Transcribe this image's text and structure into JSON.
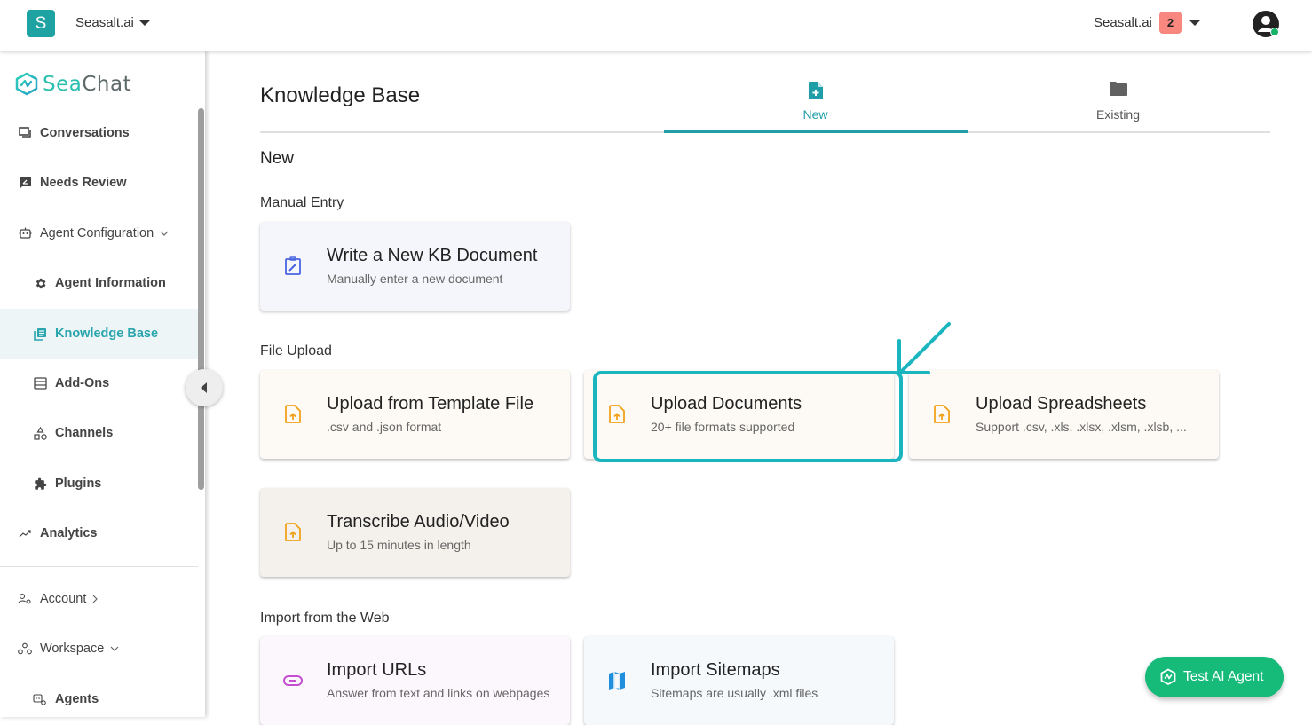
{
  "topbar": {
    "workspace_initial": "S",
    "workspace_name": "Seasalt.ai",
    "org_name": "Seasalt.ai",
    "notification_count": "2"
  },
  "sidebar": {
    "logo": {
      "part1": "Sea",
      "part2": "Chat"
    },
    "items": [
      {
        "label": "Conversations",
        "icon": "chat-bubbles-icon"
      },
      {
        "label": "Needs Review",
        "icon": "review-flag-icon"
      },
      {
        "label": "Agent Configuration",
        "icon": "robot-icon",
        "expanded": true
      },
      {
        "label": "Agent Information",
        "icon": "gear-icon"
      },
      {
        "label": "Knowledge Base",
        "icon": "library-icon",
        "active": true
      },
      {
        "label": "Add-Ons",
        "icon": "list-box-icon"
      },
      {
        "label": "Channels",
        "icon": "shapes-icon"
      },
      {
        "label": "Plugins",
        "icon": "puzzle-icon"
      },
      {
        "label": "Analytics",
        "icon": "trending-up-icon"
      },
      {
        "label": "Account",
        "icon": "account-cog-icon",
        "expanded": false
      },
      {
        "label": "Workspace",
        "icon": "workspace-circles-icon",
        "expanded": true
      },
      {
        "label": "Agents",
        "icon": "agents-cog-icon"
      }
    ]
  },
  "main": {
    "title": "Knowledge Base",
    "tabs": [
      {
        "label": "New",
        "icon": "file-plus-icon",
        "active": true
      },
      {
        "label": "Existing",
        "icon": "folder-icon",
        "active": false
      }
    ],
    "section_title": "New",
    "groups": [
      {
        "label": "Manual Entry",
        "cards": [
          {
            "title": "Write a New KB Document",
            "subtitle": "Manually enter a new document",
            "icon": "clipboard-edit-icon"
          }
        ]
      },
      {
        "label": "File Upload",
        "cards": [
          {
            "title": "Upload from Template File",
            "subtitle": ".csv and .json format",
            "icon": "file-upload-icon"
          },
          {
            "title": "Upload Documents",
            "subtitle": "20+ file formats supported",
            "icon": "file-upload-icon",
            "highlighted": true
          },
          {
            "title": "Upload Spreadsheets",
            "subtitle": "Support .csv, .xls, .xlsx, .xlsm, .xlsb, ...",
            "icon": "file-upload-icon"
          },
          {
            "title": "Transcribe Audio/Video",
            "subtitle": "Up to 15 minutes in length",
            "icon": "file-upload-icon"
          }
        ]
      },
      {
        "label": "Import from the Web",
        "cards": [
          {
            "title": "Import URLs",
            "subtitle": "Answer from text and links on webpages",
            "icon": "link-icon"
          },
          {
            "title": "Import Sitemaps",
            "subtitle": "Sitemaps are usually .xml files",
            "icon": "map-icon"
          }
        ]
      }
    ]
  },
  "fab": {
    "label": "Test AI Agent"
  },
  "colors": {
    "brand": "#1fa2a2",
    "active_tab": "#1f9ea8",
    "highlight": "#1ab5be",
    "upload_icon": "#f0a21c",
    "fab": "#16bb7a",
    "badge": "#f8877f"
  }
}
